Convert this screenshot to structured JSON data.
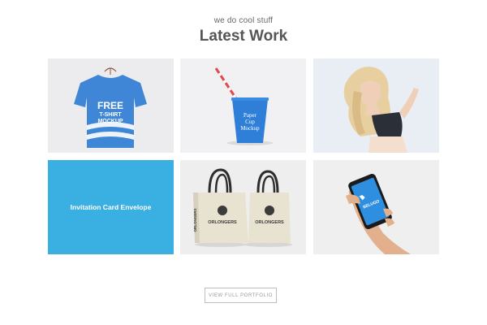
{
  "header": {
    "eyebrow": "we do cool stuff",
    "title": "Latest Work"
  },
  "portfolio": {
    "tiles": [
      {
        "name": "tshirt-mockup",
        "lines": [
          "FREE",
          "T-SHIRT",
          "MOCKUP"
        ]
      },
      {
        "name": "paper-cup-mockup",
        "lines": [
          "Paper",
          "Cup",
          "Mockup"
        ]
      },
      {
        "name": "model-photo"
      },
      {
        "name": "invitation-card",
        "caption": "Invitation Card Envelope"
      },
      {
        "name": "tote-bag-mockup",
        "brand": "ORLONGERS",
        "side_text": "ORLONGERS"
      },
      {
        "name": "phone-mockup",
        "app_label": "BELUGO"
      }
    ],
    "button_label": "VIEW FULL PORTFOLIO"
  },
  "colors": {
    "accent_blue": "#3ab0e2",
    "tshirt_blue": "#3f86d6",
    "heading": "#555555"
  }
}
